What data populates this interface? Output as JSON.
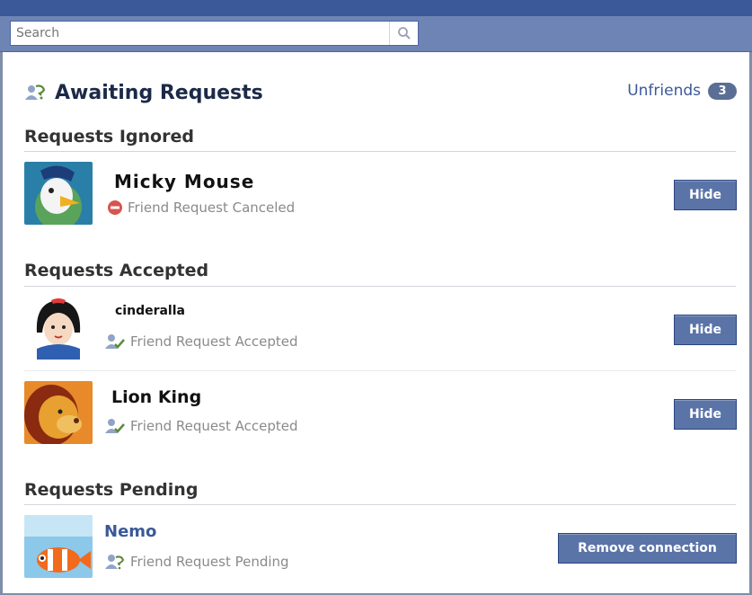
{
  "search": {
    "placeholder": "Search"
  },
  "header": {
    "title": "Awaiting Requests",
    "unfriends_label": "Unfriends",
    "unfriends_count": "3"
  },
  "sections": {
    "ignored": {
      "title": "Requests Ignored",
      "items": [
        {
          "name": "Micky Mouse",
          "status": "Friend Request Canceled",
          "action": "Hide"
        }
      ]
    },
    "accepted": {
      "title": "Requests Accepted",
      "items": [
        {
          "name": "cinderalla",
          "status": "Friend Request Accepted",
          "action": "Hide"
        },
        {
          "name": "Lion King",
          "status": "Friend Request Accepted",
          "action": "Hide"
        }
      ]
    },
    "pending": {
      "title": "Requests Pending",
      "items": [
        {
          "name": "Nemo",
          "status": "Friend Request Pending",
          "action": "Remove connection"
        }
      ]
    }
  },
  "colors": {
    "brand": "#3b5998",
    "button": "#5b74a8",
    "canceled": "#d9534f",
    "accepted": "#5a8a3a"
  }
}
